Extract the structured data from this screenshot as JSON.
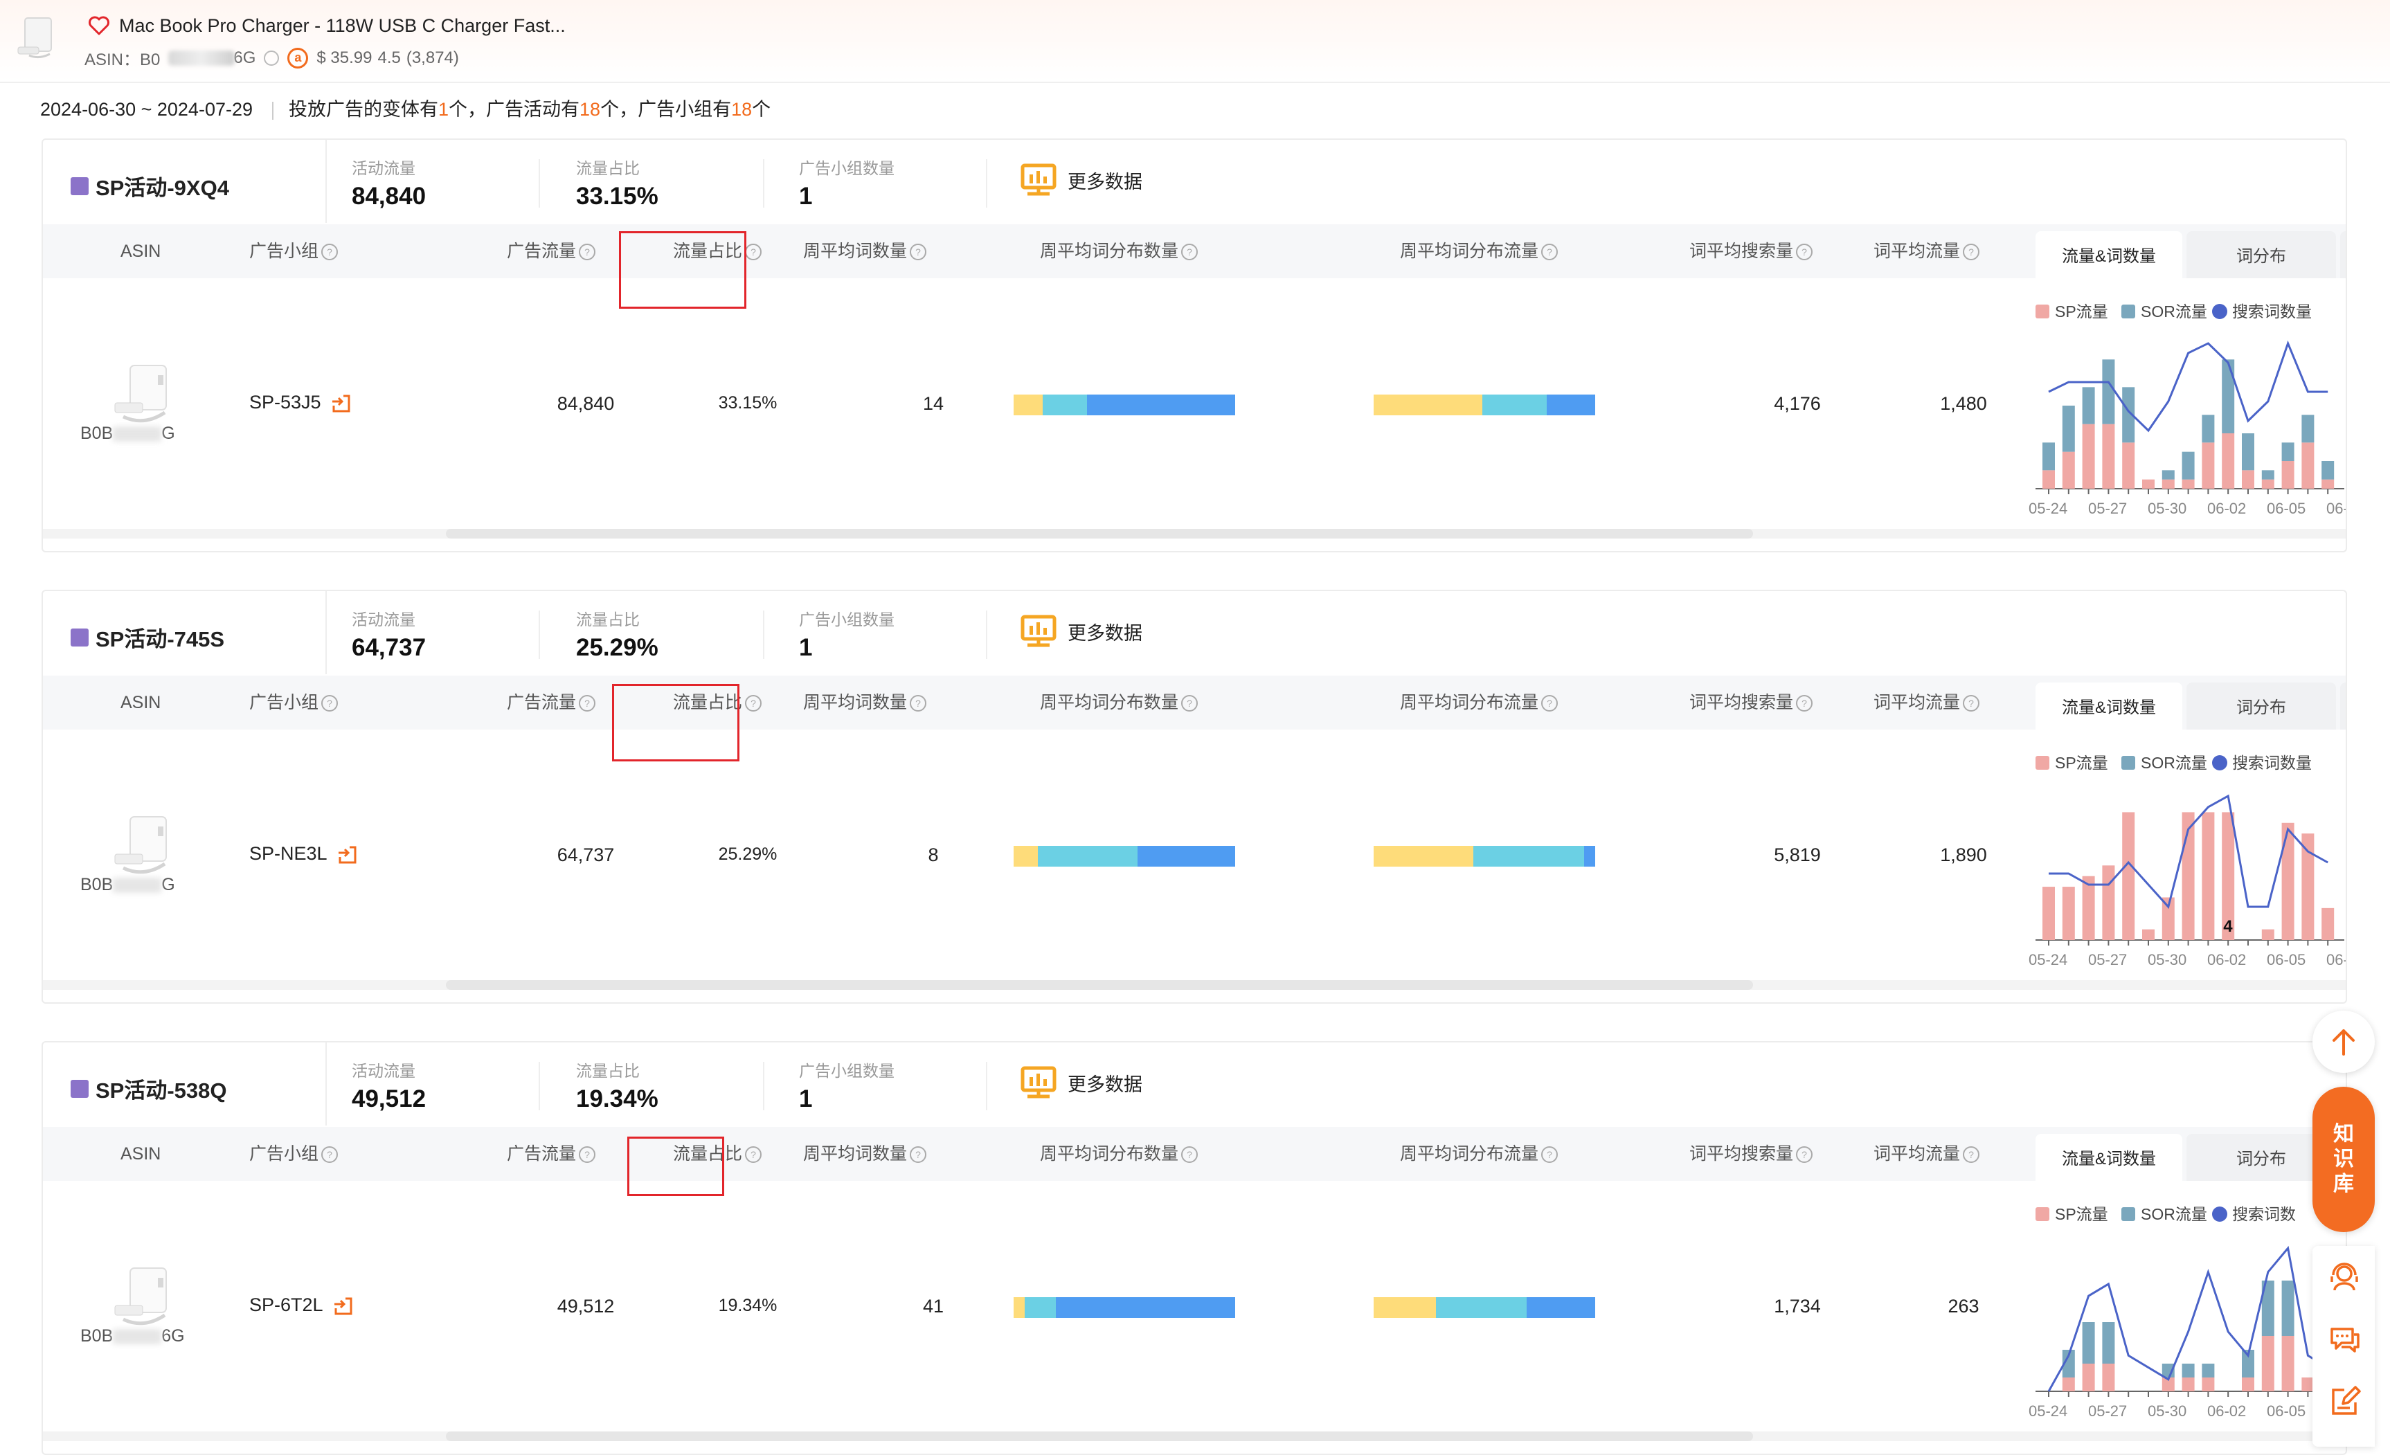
{
  "product": {
    "title": "Mac Book Pro Charger - 118W USB C Charger Fast...",
    "asin_label": "ASIN：B0",
    "asin_suffix": "6G",
    "price": "$ 35.99",
    "rating": "4.5",
    "reviews": "(3,874)"
  },
  "summary": {
    "date_range": "2024-06-30 ~ 2024-07-29",
    "text_a": "投放广告的变体有",
    "variants": "1",
    "text_b": "个，广告活动有",
    "campaigns": "18",
    "text_c": "个，广告小组有",
    "groups": "18",
    "text_d": "个"
  },
  "labels": {
    "metric_traffic": "活动流量",
    "metric_share": "流量占比",
    "metric_groups": "广告小组数量",
    "more_data": "更多数据",
    "col_asin": "ASIN",
    "col_group": "广告小组",
    "col_ad_traffic": "广告流量",
    "col_share": "流量占比",
    "col_weekly_kw": "周平均词数量",
    "col_weekly_dist_count": "周平均词分布数量",
    "col_weekly_dist_traffic": "周平均词分布流量",
    "col_avg_search": "词平均搜索量",
    "col_avg_traffic": "词平均流量",
    "tab_traffic_kw": "流量&词数量",
    "tab_dist": "词分布",
    "legend_sp": "SP流量",
    "legend_sor": "SOR流量",
    "legend_kw": "搜索词数量",
    "legend_kw_truncated": "搜索词数"
  },
  "colors": {
    "accent": "#f26b1d",
    "campaign_square": "#8b73c9",
    "sp": "#f0a8a4",
    "sor": "#7aa7bd",
    "kw_line": "#4a63c8",
    "bar_yellow": "#fedc7a",
    "bar_cyan": "#6bd0e4",
    "bar_blue": "#4f9cf2",
    "highlight_box": "#e2252b"
  },
  "campaigns": [
    {
      "name": "SP活动-9XQ4",
      "traffic": "84,840",
      "share": "33.15%",
      "groups": "1",
      "row": {
        "asin": "B0B",
        "asin_tail": "G",
        "group": "SP-53J5",
        "ad_traffic": "84,840",
        "share": "33.15%",
        "weekly_kw": "14",
        "avg_search": "4,176",
        "avg_traffic": "1,480",
        "dist_count": [
          0.13,
          0.2,
          0.67
        ],
        "dist_traffic": [
          0.49,
          0.29,
          0.22
        ]
      },
      "chart_data": {
        "type": "bar",
        "x": [
          "05-24",
          "05-25",
          "05-26",
          "05-27",
          "05-28",
          "05-29",
          "05-30",
          "05-31",
          "06-01",
          "06-02",
          "06-03",
          "06-04",
          "06-05",
          "06-06",
          "06-07"
        ],
        "x_tick_labels": [
          "05-24",
          "05-27",
          "05-30",
          "06-02",
          "06-05",
          "06-"
        ],
        "series": [
          {
            "name": "SP流量",
            "values": [
              2,
              4,
              7,
              7,
              5,
              1,
              1,
              1,
              5,
              6,
              2,
              1,
              3,
              5,
              1
            ]
          },
          {
            "name": "SOR流量",
            "values": [
              3,
              5,
              4,
              7,
              6,
              0,
              1,
              3,
              3,
              8,
              4,
              1,
              2,
              3,
              2
            ]
          },
          {
            "name": "搜索词数量",
            "values": [
              10,
              11,
              11,
              11,
              8,
              6,
              9,
              14,
              15,
              13,
              7,
              9,
              15,
              10,
              10
            ]
          }
        ],
        "ymax_bars": 15,
        "ymax_line": 16
      }
    },
    {
      "name": "SP活动-745S",
      "traffic": "64,737",
      "share": "25.29%",
      "groups": "1",
      "row": {
        "asin": "B0B",
        "asin_tail": "G",
        "group": "SP-NE3L",
        "ad_traffic": "64,737",
        "share": "25.29%",
        "weekly_kw": "8",
        "avg_search": "5,819",
        "avg_traffic": "1,890",
        "dist_count": [
          0.11,
          0.45,
          0.44
        ],
        "dist_traffic": [
          0.45,
          0.5,
          0.05
        ]
      },
      "chart_data": {
        "type": "bar",
        "x": [
          "05-24",
          "05-25",
          "05-26",
          "05-27",
          "05-28",
          "05-29",
          "05-30",
          "05-31",
          "06-01",
          "06-02",
          "06-03",
          "06-04",
          "06-05",
          "06-06",
          "06-07"
        ],
        "x_tick_labels": [
          "05-24",
          "05-27",
          "05-30",
          "06-02",
          "06-05",
          "06-"
        ],
        "annotation": "4",
        "series": [
          {
            "name": "SP流量",
            "values": [
              5,
              5,
              6,
              7,
              12,
              1,
              4,
              12,
              12,
              12,
              0,
              1,
              11,
              10,
              3
            ]
          },
          {
            "name": "SOR流量",
            "values": [
              0,
              0,
              0,
              0,
              0,
              0,
              0,
              0,
              0,
              0,
              0,
              0,
              0,
              0,
              0
            ]
          },
          {
            "name": "搜索词数量",
            "values": [
              6,
              6,
              5,
              5,
              7,
              5,
              3,
              10,
              12,
              13,
              3,
              3,
              10,
              8,
              7
            ]
          }
        ],
        "ymax_bars": 13,
        "ymax_line": 14
      }
    },
    {
      "name": "SP活动-538Q",
      "traffic": "49,512",
      "share": "19.34%",
      "groups": "1",
      "row": {
        "asin": "B0B",
        "asin_tail": "6G",
        "group": "SP-6T2L",
        "ad_traffic": "49,512",
        "share": "19.34%",
        "weekly_kw": "41",
        "avg_search": "1,734",
        "avg_traffic": "263",
        "dist_count": [
          0.05,
          0.14,
          0.81
        ],
        "dist_traffic": [
          0.28,
          0.41,
          0.31
        ]
      },
      "chart_data": {
        "type": "bar",
        "x": [
          "05-24",
          "05-25",
          "05-26",
          "05-27",
          "05-28",
          "05-29",
          "05-30",
          "05-31",
          "06-01",
          "06-02",
          "06-03",
          "06-04",
          "06-05",
          "06-06",
          "06-07"
        ],
        "x_tick_labels": [
          "05-24",
          "05-27",
          "05-30",
          "06-02",
          "06-05",
          "06-"
        ],
        "series": [
          {
            "name": "SP流量",
            "values": [
              0,
              1,
              2,
              2,
              0,
              0,
              1,
              1,
              1,
              0,
              1,
              4,
              4,
              1,
              1
            ]
          },
          {
            "name": "SOR流量",
            "values": [
              0,
              2,
              3,
              3,
              0,
              0,
              1,
              1,
              1,
              0,
              2,
              4,
              4,
              0,
              0
            ]
          },
          {
            "name": "搜索词数量",
            "values": [
              0,
              3,
              8,
              9,
              3,
              2,
              1,
              5,
              10,
              5,
              3,
              10,
              12,
              3,
              2
            ]
          }
        ],
        "ymax_bars": 10,
        "ymax_line": 13
      }
    }
  ]
}
